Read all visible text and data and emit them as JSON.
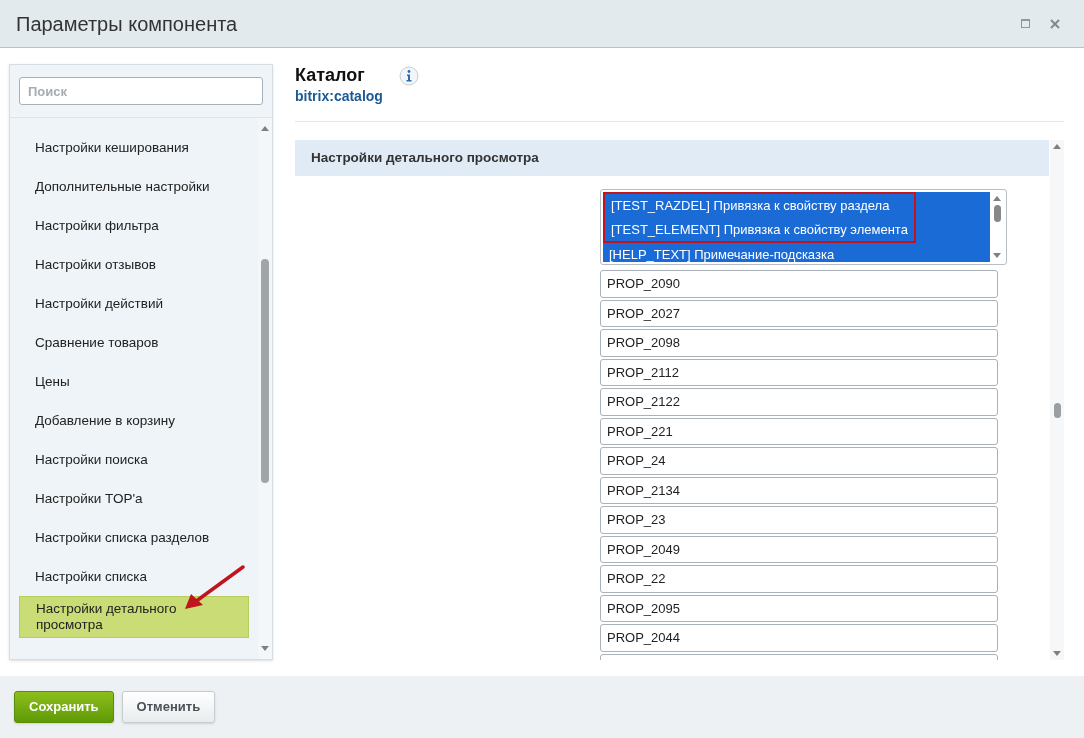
{
  "window": {
    "title": "Параметры компонента"
  },
  "sidebar": {
    "search": {
      "placeholder": "Поиск"
    },
    "items": [
      {
        "label": "Настройки кеширования",
        "selected": false
      },
      {
        "label": "Дополнительные настройки",
        "selected": false
      },
      {
        "label": "Настройки фильтра",
        "selected": false
      },
      {
        "label": "Настройки отзывов",
        "selected": false
      },
      {
        "label": "Настройки действий",
        "selected": false
      },
      {
        "label": "Сравнение товаров",
        "selected": false
      },
      {
        "label": "Цены",
        "selected": false
      },
      {
        "label": "Добавление в корзину",
        "selected": false
      },
      {
        "label": "Настройки поиска",
        "selected": false
      },
      {
        "label": "Настройки TOP'а",
        "selected": false
      },
      {
        "label": "Настройки списка разделов",
        "selected": false
      },
      {
        "label": "Настройки списка",
        "selected": false
      },
      {
        "label": "Настройки детального просмотра",
        "selected": true
      }
    ]
  },
  "component": {
    "title": "Каталог",
    "code": "bitrix:catalog"
  },
  "section": {
    "title": "Настройки детального просмотра"
  },
  "multiselect": [
    {
      "label": "[TEST_RAZDEL] Привязка к свойству раздела",
      "selected": true,
      "marked": true
    },
    {
      "label": "[TEST_ELEMENT] Привязка к свойству элемента",
      "selected": true,
      "marked": true
    },
    {
      "label": "[HELP_TEXT] Примечание-подсказка",
      "selected": true,
      "marked": false
    }
  ],
  "fields": [
    "PROP_2090",
    "PROP_2027",
    "PROP_2098",
    "PROP_2112",
    "PROP_2122",
    "PROP_221",
    "PROP_24",
    "PROP_2134",
    "PROP_23",
    "PROP_2049",
    "PROP_22",
    "PROP_2095",
    "PROP_2044"
  ],
  "buttons": [
    {
      "label": "Сохранить",
      "kind": "primary"
    },
    {
      "label": "Отменить",
      "kind": "secondary"
    }
  ]
}
